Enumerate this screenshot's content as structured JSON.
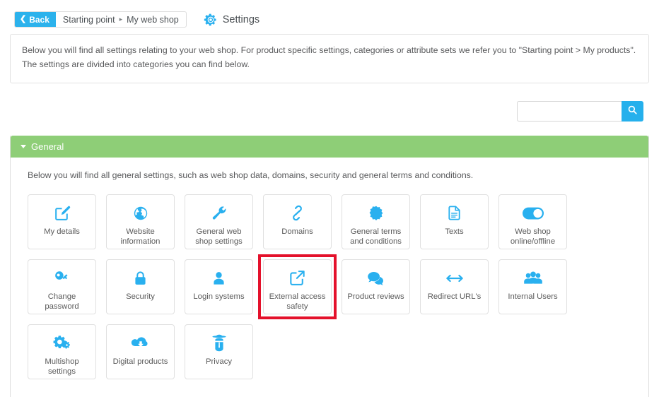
{
  "header": {
    "back_label": "Back",
    "back_icon": "arrow-left-icon",
    "breadcrumbs": [
      "Starting point",
      "My web shop"
    ],
    "breadcrumb_separator": "▸",
    "page_title": "Settings",
    "page_title_icon": "gear-icon"
  },
  "intro": {
    "text": "Below you will find all settings relating to your web shop. For product specific settings, categories or attribute sets we refer you to \"Starting point > My products\". The settings are divided into categories you can find below."
  },
  "search": {
    "value": "",
    "placeholder": "",
    "button_icon": "search-icon"
  },
  "panel": {
    "title": "General",
    "collapse_icon": "caret-down-icon",
    "header_color": "#8ece77",
    "description": "Below you will find all general settings, such as web shop data, domains, security and general terms and conditions.",
    "tiles": [
      {
        "label": "My details",
        "icon": "pencil-square-icon",
        "highlighted": false
      },
      {
        "label": "Website information",
        "icon": "globe-icon",
        "highlighted": false
      },
      {
        "label": "General web shop settings",
        "icon": "wrench-icon",
        "highlighted": false
      },
      {
        "label": "Domains",
        "icon": "chain-links-icon",
        "highlighted": false
      },
      {
        "label": "General terms and conditions",
        "icon": "certificate-badge-icon",
        "highlighted": false
      },
      {
        "label": "Texts",
        "icon": "document-lines-icon",
        "highlighted": false
      },
      {
        "label": "Web shop online/offline",
        "icon": "toggle-switch-icon",
        "highlighted": false
      },
      {
        "label": "Change password",
        "icon": "key-icon",
        "highlighted": false
      },
      {
        "label": "Security",
        "icon": "padlock-icon",
        "highlighted": false
      },
      {
        "label": "Login systems",
        "icon": "user-icon",
        "highlighted": false
      },
      {
        "label": "External access safety",
        "icon": "external-link-icon",
        "highlighted": true
      },
      {
        "label": "Product reviews",
        "icon": "speech-bubbles-icon",
        "highlighted": false
      },
      {
        "label": "Redirect URL's",
        "icon": "double-arrow-icon",
        "highlighted": false
      },
      {
        "label": "Internal Users",
        "icon": "users-group-icon",
        "highlighted": false
      },
      {
        "label": "Multishop settings",
        "icon": "gears-icon",
        "highlighted": false
      },
      {
        "label": "Digital products",
        "icon": "cloud-download-icon",
        "highlighted": false
      },
      {
        "label": "Privacy",
        "icon": "spy-icon",
        "highlighted": false
      }
    ]
  },
  "colors": {
    "accent_blue": "#29b0ef",
    "panel_green": "#8ece77",
    "highlight_red": "#e4112b",
    "text_gray": "#58595b"
  }
}
